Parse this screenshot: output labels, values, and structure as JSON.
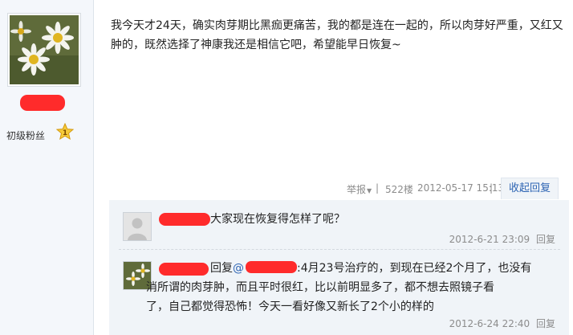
{
  "user": {
    "rank_label": "初级粉丝",
    "rank_level": "1"
  },
  "post": {
    "content": "我今天才24天，确实肉芽期比黑痂更痛苦，我的都是连在一起的，所以肉芽好严重，又红又肿的，既然选择了神康我还是相信它吧，希望能早日恢复~",
    "report_label": "举报",
    "report_arrow": "▼",
    "separator": "|",
    "floor": "522楼",
    "time": "2012-05-17 15:13",
    "collapse_label": "收起回复"
  },
  "replies": [
    {
      "text": "大家现在恢复得怎样了呢？",
      "time": "2012-6-21 23:09",
      "reply_label": "回复"
    },
    {
      "prefix": "回复",
      "mention": "@",
      "text_line1": ":4月23号治疗的，到现在已经2个月了，也没有",
      "text_line2": "消所谓的肉芽肿，而且平时很红，比以前明显多了，都不想去照镜子看",
      "text_line3": "了，自己都觉得恐怖！今天一看好像又新长了2个小的样的",
      "time": "2012-6-24 22:40",
      "reply_label": "回复"
    }
  ]
}
